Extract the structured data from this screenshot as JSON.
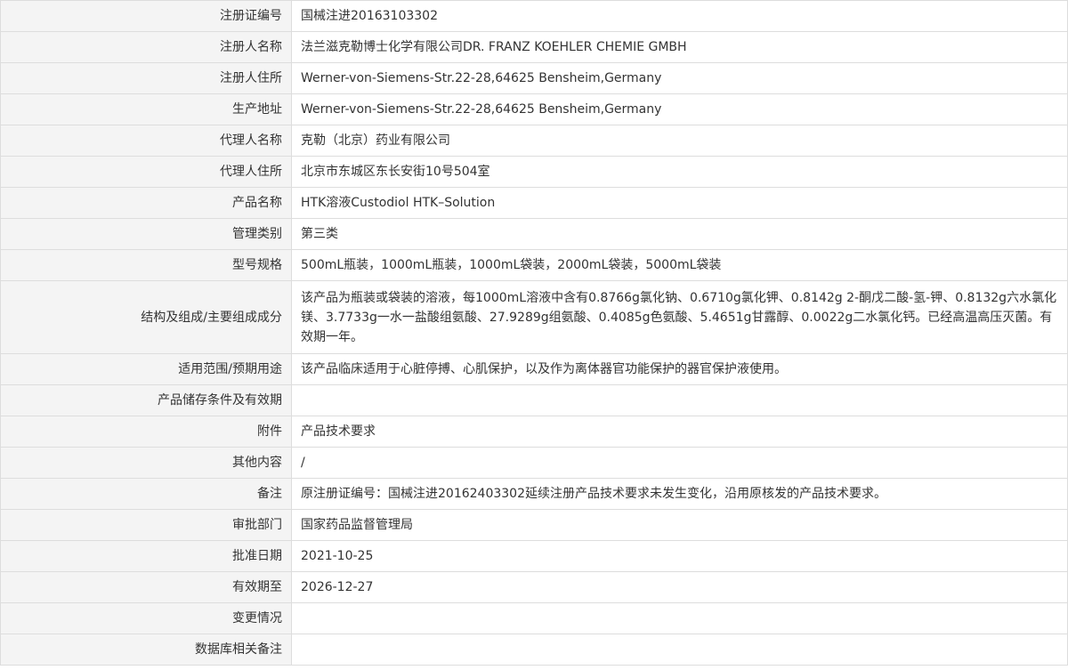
{
  "rows": [
    {
      "label": "注册证编号",
      "value": "国械注进20163103302"
    },
    {
      "label": "注册人名称",
      "value": "法兰滋克勒博士化学有限公司DR. FRANZ KOEHLER CHEMIE GMBH"
    },
    {
      "label": "注册人住所",
      "value": "Werner-von-Siemens-Str.22-28,64625 Bensheim,Germany"
    },
    {
      "label": "生产地址",
      "value": "Werner-von-Siemens-Str.22-28,64625 Bensheim,Germany"
    },
    {
      "label": "代理人名称",
      "value": "克勒（北京）药业有限公司"
    },
    {
      "label": "代理人住所",
      "value": "北京市东城区东长安街10号504室"
    },
    {
      "label": "产品名称",
      "value": "HTK溶液Custodiol HTK–Solution"
    },
    {
      "label": "管理类别",
      "value": "第三类"
    },
    {
      "label": "型号规格",
      "value": "500mL瓶装，1000mL瓶装，1000mL袋装，2000mL袋装，5000mL袋装"
    },
    {
      "label": "结构及组成/主要组成成分",
      "value": "该产品为瓶装或袋装的溶液，每1000mL溶液中含有0.8766g氯化钠、0.6710g氯化钾、0.8142g 2-酮戊二酸-氢-钾、0.8132g六水氯化镁、3.7733g一水一盐酸组氨酸、27.9289g组氨酸、0.4085g色氨酸、5.4651g甘露醇、0.0022g二水氯化钙。已经高温高压灭菌。有效期一年。"
    },
    {
      "label": "适用范围/预期用途",
      "value": "该产品临床适用于心脏停搏、心肌保护，以及作为离体器官功能保护的器官保护液使用。"
    },
    {
      "label": "产品储存条件及有效期",
      "value": ""
    },
    {
      "label": "附件",
      "value": "产品技术要求"
    },
    {
      "label": "其他内容",
      "value": "/"
    },
    {
      "label": "备注",
      "value": "原注册证编号：国械注进20162403302延续注册产品技术要求未发生变化，沿用原核发的产品技术要求。"
    },
    {
      "label": "审批部门",
      "value": "国家药品监督管理局"
    },
    {
      "label": "批准日期",
      "value": "2021-10-25"
    },
    {
      "label": "有效期至",
      "value": "2026-12-27"
    },
    {
      "label": "变更情况",
      "value": ""
    },
    {
      "label": "数据库相关备注",
      "value": ""
    }
  ]
}
